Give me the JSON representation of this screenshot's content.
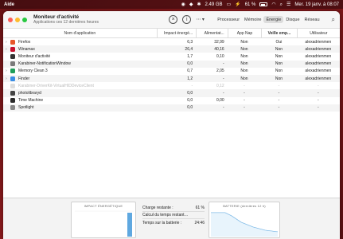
{
  "menubar": {
    "app": "Aide",
    "memory": "2.49 GB",
    "battery_pct": "61 %",
    "datetime": "Mer. 19 janv. à 08:07"
  },
  "window": {
    "title": "Moniteur d'activité",
    "subtitle": "Applications ces 12 dernières heures",
    "tabs": [
      "Processeur",
      "Mémoire",
      "Énergie",
      "Disque",
      "Réseau"
    ],
    "active_tab": "Énergie"
  },
  "table": {
    "headers": {
      "name": "Nom d'application",
      "impact": "Impact énergé...",
      "alimentation": "Alimentat...",
      "app_nap": "App Nap",
      "veille": "Veille emp...",
      "user": "Utilisateur"
    },
    "rows": [
      {
        "chev": "›",
        "icon_color": "#e8562a",
        "icon": "firefox-icon",
        "name": "Firefox",
        "impact": "6,3",
        "alim": "32,99",
        "nap": "Non",
        "veille": "Oui",
        "user": "alexadrienmen",
        "dim": false
      },
      {
        "chev": "›",
        "icon_color": "#c8102e",
        "icon": "winamax-icon",
        "name": "Winamax",
        "impact": "26,4",
        "alim": "40,16",
        "nap": "Non",
        "veille": "Non",
        "user": "alexadrienmen",
        "dim": false
      },
      {
        "chev": "",
        "icon_color": "#333333",
        "icon": "activity-monitor-icon",
        "name": "Moniteur d'activité",
        "impact": "1,7",
        "alim": "0,10",
        "nap": "Non",
        "veille": "Non",
        "user": "alexadrienmen",
        "dim": false
      },
      {
        "chev": "",
        "icon_color": "#7a7a7a",
        "icon": "karabiner-icon",
        "name": "Karabiner-NotificationWindow",
        "impact": "0,0",
        "alim": "-",
        "nap": "Non",
        "veille": "Non",
        "user": "alexadrienmen",
        "dim": false
      },
      {
        "chev": "›",
        "icon_color": "#1f9e5a",
        "icon": "memory-clean-icon",
        "name": "Memory Clean 3",
        "impact": "0,7",
        "alim": "2,05",
        "nap": "Non",
        "veille": "Non",
        "user": "alexadrienmen",
        "dim": false
      },
      {
        "chev": "›",
        "icon_color": "#3a8ee6",
        "icon": "finder-icon",
        "name": "Finder",
        "impact": "1,2",
        "alim": "-",
        "nap": "Non",
        "veille": "Non",
        "user": "alexadrienmen",
        "dim": false
      },
      {
        "chev": "",
        "icon_color": "#dddddd",
        "icon": "karabiner-driverkit-icon",
        "name": "Karabiner-DriverKit-VirtualHIDDeviceClient",
        "impact": "-",
        "alim": "0,12",
        "nap": "-",
        "veille": "-",
        "user": "-",
        "dim": true
      },
      {
        "chev": "",
        "icon_color": "#444444",
        "icon": "photolibraryd-icon",
        "name": "photolibraryd",
        "impact": "0,0",
        "alim": "-",
        "nap": "-",
        "veille": "-",
        "user": "-",
        "dim": false
      },
      {
        "chev": "",
        "icon_color": "#2b2b2b",
        "icon": "time-machine-icon",
        "name": "Time Machine",
        "impact": "0,0",
        "alim": "0,00",
        "nap": "-",
        "veille": "-",
        "user": "-",
        "dim": false
      },
      {
        "chev": "",
        "icon_color": "#888888",
        "icon": "spotlight-icon",
        "name": "Spotlight",
        "impact": "0,0",
        "alim": "-",
        "nap": "-",
        "veille": "-",
        "user": "-",
        "dim": false
      }
    ]
  },
  "bottom": {
    "impact_title": "IMPACT ÉNERGÉTIQUE",
    "battery_title": "BATTERIE (dernières 12 h)",
    "stats": [
      {
        "label": "Charge restante :",
        "value": "61 %"
      },
      {
        "label": "Calcul du temps restant…",
        "value": ""
      },
      {
        "label": "Temps sur la batterie :",
        "value": "24:46"
      }
    ],
    "battery_level_pct": 61
  },
  "colors": {
    "accent": "#c8102e",
    "chart_line": "#5fa8e0"
  }
}
